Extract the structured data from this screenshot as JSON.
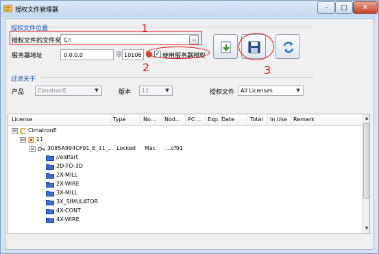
{
  "window": {
    "title": "授权文件管理器",
    "buttons": {
      "minimize": "–",
      "maximize": "□",
      "close": "✕"
    }
  },
  "license_location": {
    "group_title": "授权文件位置",
    "folder_label": "授权文件的文件夹",
    "folder_value": "C:\\",
    "browse_label": "...",
    "server_label": "服务器地址",
    "server_value": "0.0.0.0",
    "port_symbol": "@",
    "port_value": "10106",
    "use_server_label": "使用服务器授权",
    "use_server_checked": "✓"
  },
  "filter": {
    "group_title": "过滤关于",
    "product_label": "产品",
    "product_value": "CimatronE",
    "version_label": "版本",
    "version_value": "11",
    "license_file_label": "授权文件",
    "license_file_value": "All Licenses"
  },
  "toolbar": {
    "import_icon": "import-icon",
    "save_icon": "save-icon",
    "refresh_icon": "refresh-icon"
  },
  "annotations": {
    "n1": "1",
    "n2": "2",
    "n3": "3",
    "color": "#e4141e"
  },
  "table": {
    "columns": [
      "License",
      "Type",
      "No...",
      "Nod...",
      "PC ...",
      "Exp. Date",
      "Total",
      "In Use",
      "Remark"
    ],
    "rows": [
      {
        "label": "CimatronE",
        "level": 0,
        "expander": "⊟",
        "icon": "cimatron-logo-icon"
      },
      {
        "label": "11",
        "level": 1,
        "expander": "⊟",
        "icon": "version-icon"
      },
      {
        "label": "3085A994CF91_E_11_...",
        "level": 2,
        "expander": "⊟",
        "icon": "key-icon",
        "type": "Locked",
        "no": "Mac",
        "nod": "...cf91"
      },
      {
        "label": "//oldfart",
        "level": 3,
        "icon": "folder-icon"
      },
      {
        "label": "2D-TO-3D",
        "level": 3,
        "icon": "folder-icon"
      },
      {
        "label": "2X-MILL",
        "level": 3,
        "icon": "folder-icon"
      },
      {
        "label": "2X-WIRE",
        "level": 3,
        "icon": "folder-icon"
      },
      {
        "label": "3X-MILL",
        "level": 3,
        "icon": "folder-icon"
      },
      {
        "label": "3X_SIMULATOR",
        "level": 3,
        "icon": "folder-icon"
      },
      {
        "label": "4X-CONT",
        "level": 3,
        "icon": "folder-icon"
      },
      {
        "label": "4X-WIRE",
        "level": 3,
        "icon": "folder-icon"
      }
    ]
  }
}
